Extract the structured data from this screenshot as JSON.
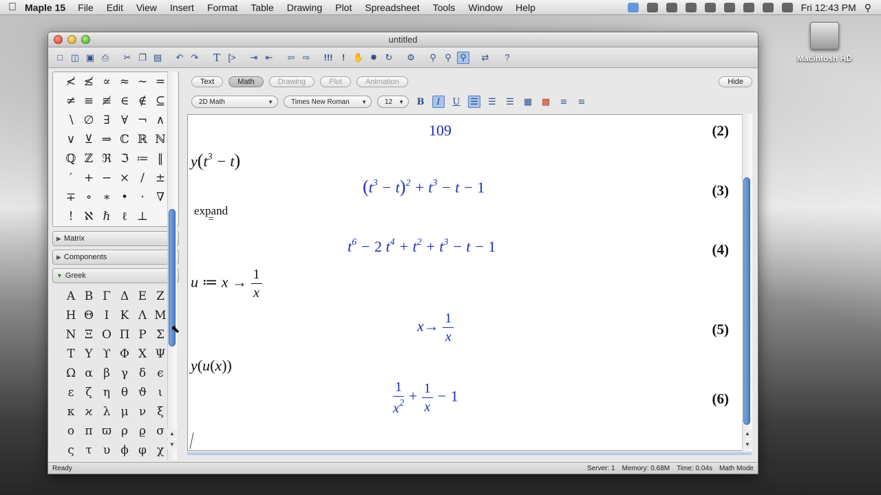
{
  "menubar": {
    "app_name": "Maple 15",
    "items": [
      "File",
      "Edit",
      "View",
      "Insert",
      "Format",
      "Table",
      "Drawing",
      "Plot",
      "Spreadsheet",
      "Tools",
      "Window",
      "Help"
    ],
    "clock": "Fri 12:43 PM"
  },
  "desktop": {
    "drive_label": "Macintosh HD"
  },
  "window": {
    "title": "untitled"
  },
  "palette": {
    "symbols_rows": [
      [
        "≮",
        "≰",
        "∝",
        "≈",
        "∼",
        "="
      ],
      [
        "≠",
        "≡",
        "≢",
        "∈",
        "∉",
        "⊆"
      ],
      [
        "∖",
        "∅",
        "∃",
        "∀",
        "¬",
        "∧"
      ],
      [
        "∨",
        "⊻",
        "⇒",
        "ℂ",
        "ℝ",
        "ℕ"
      ],
      [
        "ℚ",
        "ℤ",
        "ℜ",
        "ℑ",
        "≔",
        "‖"
      ],
      [
        "′",
        "+",
        "−",
        "×",
        "/",
        "±"
      ],
      [
        "∓",
        "∘",
        "∗",
        "•",
        "·",
        "∇"
      ],
      [
        "!",
        "ℵ",
        "ℏ",
        "ℓ",
        "⊥",
        ""
      ]
    ],
    "sections": [
      {
        "label": "Matrix",
        "open": false
      },
      {
        "label": "Components",
        "open": false
      },
      {
        "label": "Greek",
        "open": true
      }
    ],
    "greek_rows": [
      [
        "Α",
        "Β",
        "Γ",
        "Δ",
        "Ε",
        "Ζ"
      ],
      [
        "Η",
        "Θ",
        "Ι",
        "Κ",
        "Λ",
        "Μ"
      ],
      [
        "Ν",
        "Ξ",
        "Ο",
        "Π",
        "Ρ",
        "Σ"
      ],
      [
        "Τ",
        "Υ",
        "ϒ",
        "Φ",
        "Χ",
        "Ψ"
      ],
      [
        "Ω",
        "α",
        "β",
        "γ",
        "δ",
        "ϵ"
      ],
      [
        "ε",
        "ζ",
        "η",
        "θ",
        "ϑ",
        "ι"
      ],
      [
        "κ",
        "ϰ",
        "λ",
        "μ",
        "ν",
        "ξ"
      ],
      [
        "ο",
        "π",
        "ϖ",
        "ρ",
        "ϱ",
        "σ"
      ],
      [
        "ς",
        "τ",
        "υ",
        "ϕ",
        "φ",
        "χ"
      ]
    ]
  },
  "doc_toolbar": {
    "modes": [
      {
        "label": "Text",
        "state": "normal"
      },
      {
        "label": "Math",
        "state": "active"
      },
      {
        "label": "Drawing",
        "state": "disabled"
      },
      {
        "label": "Plot",
        "state": "disabled"
      },
      {
        "label": "Animation",
        "state": "disabled"
      }
    ],
    "hide_label": "Hide",
    "math_mode": "2D Math",
    "font": "Times New Roman",
    "size": "12",
    "bold": "B",
    "italic": "I",
    "underline": "U"
  },
  "document": {
    "labels": [
      "(2)",
      "(3)",
      "(4)",
      "(5)",
      "(6)"
    ],
    "output_109": "109",
    "expand_word": "expand",
    "cursor_note": ""
  },
  "status": {
    "left": "Ready",
    "server": "Server: 1",
    "memory": "Memory: 0.68M",
    "time": "Time: 0.04s",
    "mode": "Math Mode"
  }
}
